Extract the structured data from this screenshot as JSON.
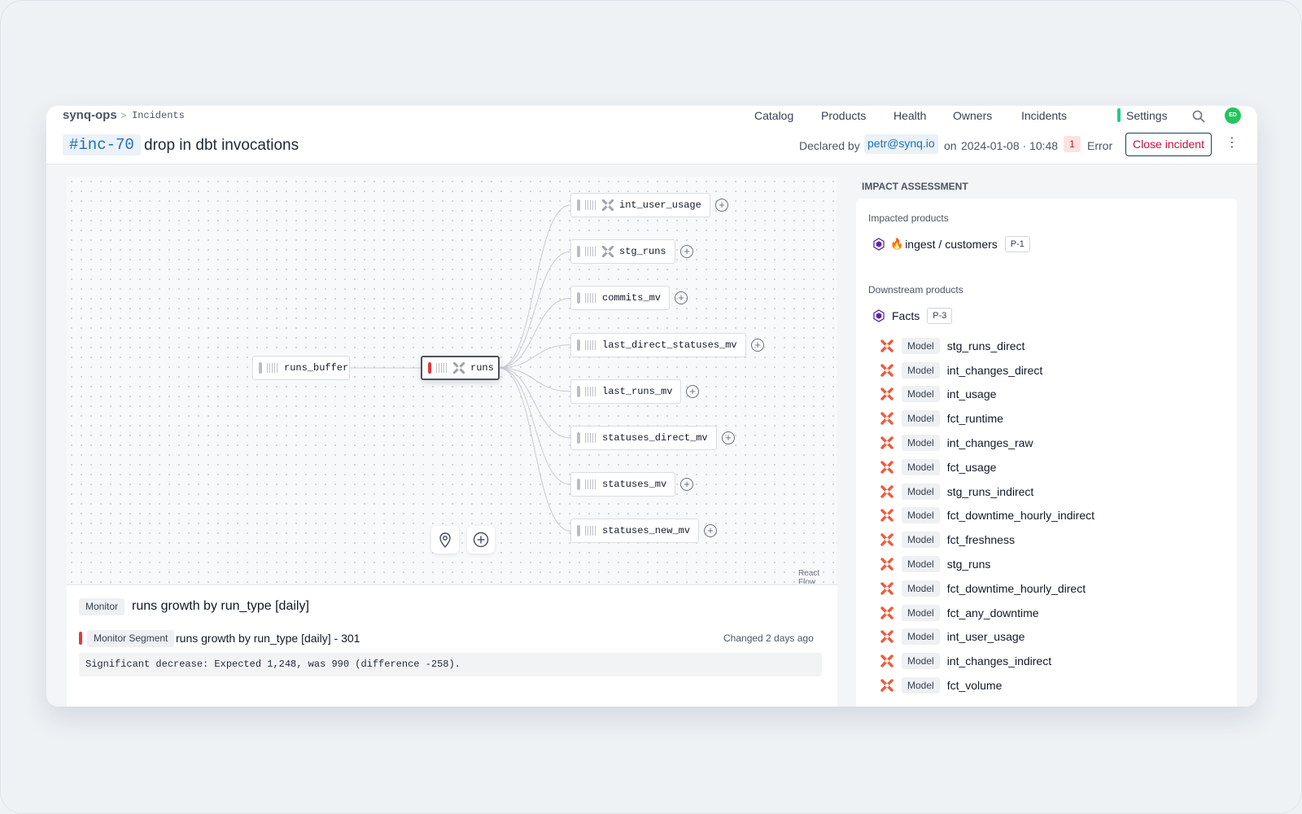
{
  "header": {
    "org": "synq-ops",
    "breadcrumb_sep": ">",
    "breadcrumb": "Incidents",
    "nav": [
      {
        "label": "Catalog"
      },
      {
        "label": "Products"
      },
      {
        "label": "Health"
      },
      {
        "label": "Owners"
      },
      {
        "label": "Incidents"
      },
      {
        "label": "Settings"
      }
    ],
    "search_icon": "search-icon",
    "avatar_initials": "ED",
    "avatar_color": "#22c55e",
    "settings_accent": "#25c98a"
  },
  "incident": {
    "id": "#inc-70",
    "title": "drop in dbt invocations",
    "declared_label": "Declared by",
    "declared_by": "petr@synq.io",
    "on_label": "on",
    "declared_at": "2024-01-08 · 10:48",
    "error_count": "1",
    "error_label": "Error",
    "close_label": "Close incident",
    "more_icon": "⋮"
  },
  "lineage": {
    "source": {
      "label": "runs_buffer"
    },
    "selected": {
      "label": "runs",
      "status_color": "#e5383b"
    },
    "downstream": [
      {
        "label": "int_user_usage",
        "dbt": true
      },
      {
        "label": "stg_runs",
        "dbt": true
      },
      {
        "label": "commits_mv",
        "dbt": false
      },
      {
        "label": "last_direct_statuses_mv",
        "dbt": false
      },
      {
        "label": "last_runs_mv",
        "dbt": false
      },
      {
        "label": "statuses_direct_mv",
        "dbt": false
      },
      {
        "label": "statuses_mv",
        "dbt": false
      },
      {
        "label": "statuses_new_mv",
        "dbt": false
      }
    ],
    "expand_symbol": "+",
    "controls": [
      "location-pin-icon",
      "add-circle-icon"
    ],
    "credit": "React Flow"
  },
  "monitor": {
    "chip": "Monitor",
    "title": "runs growth by run_type [daily]",
    "segment_chip": "Monitor Segment",
    "segment_title": "runs growth by run_type [daily] - 301",
    "changed": "Changed 2 days ago",
    "alert_text": "Significant decrease: Expected 1,248, was 990 (difference -258)."
  },
  "impact": {
    "heading": "IMPACT ASSESSMENT",
    "impacted_heading": "Impacted products",
    "impacted": [
      {
        "emoji": "🔥",
        "name": "ingest / customers",
        "priority": "P-1"
      }
    ],
    "downstream_heading": "Downstream products",
    "downstream_product": {
      "name": "Facts",
      "priority": "P-3"
    },
    "model_chip": "Model",
    "models": [
      "stg_runs_direct",
      "int_changes_direct",
      "int_usage",
      "fct_runtime",
      "int_changes_raw",
      "fct_usage",
      "stg_runs_indirect",
      "fct_downtime_hourly_indirect",
      "fct_freshness",
      "stg_runs",
      "fct_downtime_hourly_direct",
      "fct_any_downtime",
      "int_user_usage",
      "int_changes_indirect",
      "fct_volume"
    ],
    "product_icon_color": "#4c1d95",
    "dbt_icon_color": "#ef5a3c"
  }
}
